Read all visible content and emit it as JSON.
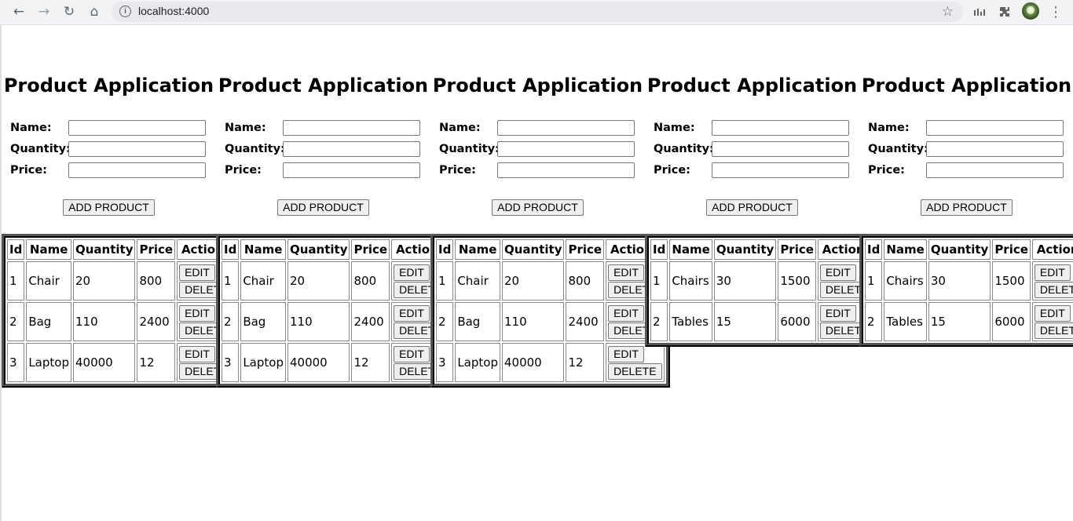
{
  "browser": {
    "url": "localhost:4000",
    "back_icon": "←",
    "forward_icon": "→",
    "reload_icon": "↻",
    "home_icon": "⌂",
    "info_icon": "i",
    "star_icon": "☆",
    "menu_icon": "⋮"
  },
  "apps": [
    {
      "title": "Product Application",
      "form": {
        "name_label": "Name:",
        "quantity_label": "Quantity:",
        "price_label": "Price:",
        "add_label": "ADD PRODUCT"
      },
      "headers": [
        "Id",
        "Name",
        "Quantity",
        "Price",
        "Actions"
      ],
      "rows": [
        {
          "id": "1",
          "name": "Chair",
          "quantity": "20",
          "price": "800"
        },
        {
          "id": "2",
          "name": "Bag",
          "quantity": "110",
          "price": "2400"
        },
        {
          "id": "3",
          "name": "Laptop",
          "quantity": "40000",
          "price": "12"
        }
      ],
      "edit_label": "EDIT",
      "delete_label": "DELETE"
    },
    {
      "title": "Product Application",
      "form": {
        "name_label": "Name:",
        "quantity_label": "Quantity:",
        "price_label": "Price:",
        "add_label": "ADD PRODUCT"
      },
      "headers": [
        "Id",
        "Name",
        "Quantity",
        "Price",
        "Actions"
      ],
      "rows": [
        {
          "id": "1",
          "name": "Chair",
          "quantity": "20",
          "price": "800"
        },
        {
          "id": "2",
          "name": "Bag",
          "quantity": "110",
          "price": "2400"
        },
        {
          "id": "3",
          "name": "Laptop",
          "quantity": "40000",
          "price": "12"
        }
      ],
      "edit_label": "EDIT",
      "delete_label": "DELETE"
    },
    {
      "title": "Product Application",
      "form": {
        "name_label": "Name:",
        "quantity_label": "Quantity:",
        "price_label": "Price:",
        "add_label": "ADD PRODUCT"
      },
      "headers": [
        "Id",
        "Name",
        "Quantity",
        "Price",
        "Actions"
      ],
      "rows": [
        {
          "id": "1",
          "name": "Chair",
          "quantity": "20",
          "price": "800"
        },
        {
          "id": "2",
          "name": "Bag",
          "quantity": "110",
          "price": "2400"
        },
        {
          "id": "3",
          "name": "Laptop",
          "quantity": "40000",
          "price": "12"
        }
      ],
      "edit_label": "EDIT",
      "delete_label": "DELETE"
    },
    {
      "title": "Product Application",
      "form": {
        "name_label": "Name:",
        "quantity_label": "Quantity:",
        "price_label": "Price:",
        "add_label": "ADD PRODUCT"
      },
      "headers": [
        "Id",
        "Name",
        "Quantity",
        "Price",
        "Actions"
      ],
      "rows": [
        {
          "id": "1",
          "name": "Chairs",
          "quantity": "30",
          "price": "1500"
        },
        {
          "id": "2",
          "name": "Tables",
          "quantity": "15",
          "price": "6000"
        }
      ],
      "edit_label": "EDIT",
      "delete_label": "DELETE"
    },
    {
      "title": "Product Application",
      "form": {
        "name_label": "Name:",
        "quantity_label": "Quantity:",
        "price_label": "Price:",
        "add_label": "ADD PRODUCT"
      },
      "headers": [
        "Id",
        "Name",
        "Quantity",
        "Price",
        "Actions"
      ],
      "rows": [
        {
          "id": "1",
          "name": "Chairs",
          "quantity": "30",
          "price": "1500"
        },
        {
          "id": "2",
          "name": "Tables",
          "quantity": "15",
          "price": "6000"
        }
      ],
      "edit_label": "EDIT",
      "delete_label": "DELETE"
    }
  ]
}
